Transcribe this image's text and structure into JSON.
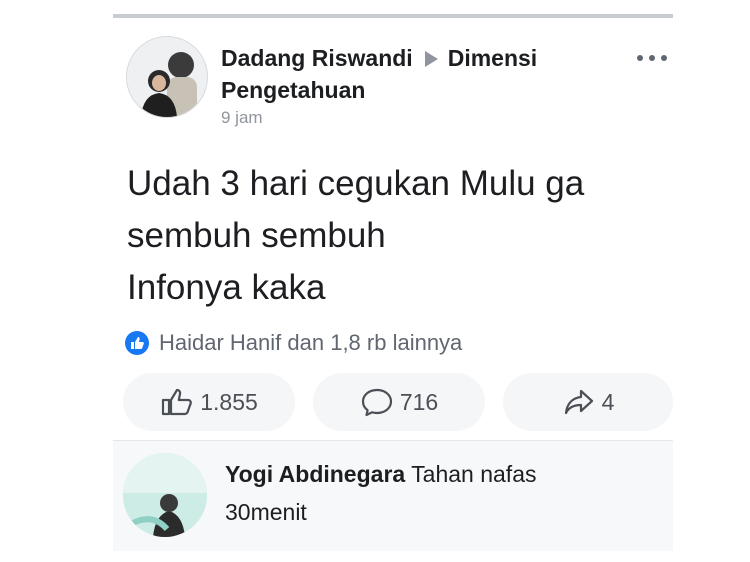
{
  "post": {
    "author": "Dadang Riswandi",
    "group": "Dimensi Pengetahuan",
    "time": "9 jam",
    "text_lines": [
      "Udah 3 hari cegukan Mulu ga",
      "sembuh sembuh",
      "Infonya kaka"
    ],
    "reaction_summary": "Haidar Hanif dan 1,8 rb lainnya",
    "likes": "1.855",
    "comments": "716",
    "shares": "4"
  },
  "comment": {
    "author": "Yogi Abdinegara",
    "text_first": "Tahan nafas",
    "text_second": "30menit"
  },
  "icons": {
    "more": "ellipsis-icon",
    "like": "thumbs-up-icon",
    "comment": "speech-bubble-icon",
    "share": "share-arrow-icon",
    "badge": "like-badge-icon"
  },
  "colors": {
    "accent": "#1877f2",
    "secondary_text": "#90949c",
    "button_bg": "#f5f6f7"
  }
}
